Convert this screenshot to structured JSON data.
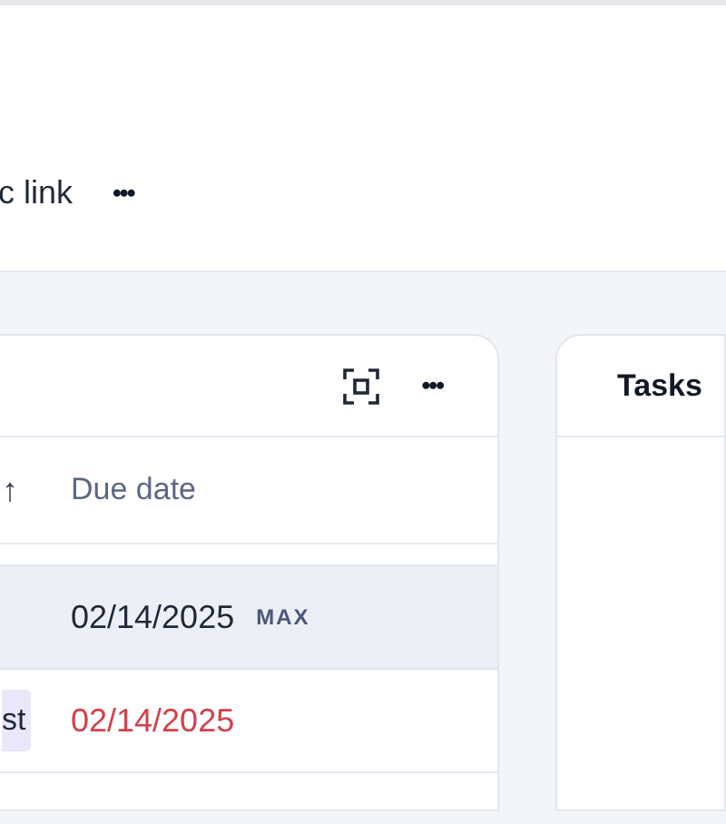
{
  "header": {
    "link_label": "c link",
    "more_label": "•••"
  },
  "table_card": {
    "more_label": "•••",
    "sort_arrow": "↑",
    "columns": [
      {
        "label": "Due date"
      }
    ],
    "rows": [
      {
        "kind": "summary",
        "date": "02/14/2025",
        "aggregate": "MAX",
        "overdue": false
      },
      {
        "kind": "item",
        "tag": "st",
        "date": "02/14/2025",
        "overdue": true
      }
    ]
  },
  "tasks_card": {
    "title": "Tasks"
  }
}
